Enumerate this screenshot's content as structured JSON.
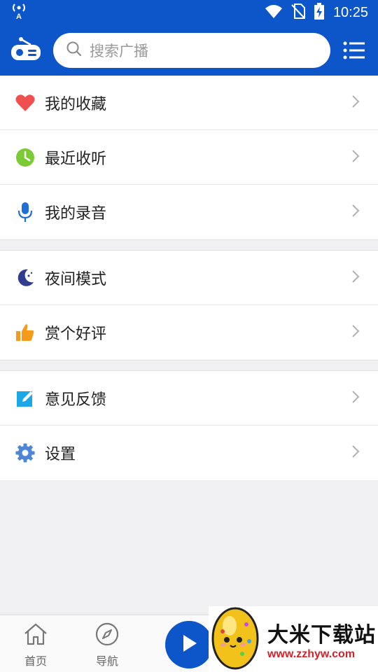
{
  "status_bar": {
    "time": "10:25"
  },
  "search": {
    "placeholder": "搜索广播"
  },
  "menu_groups": [
    [
      {
        "label": "我的收藏",
        "icon": "heart-icon",
        "color": "#ef4f4f"
      },
      {
        "label": "最近收听",
        "icon": "clock-icon",
        "color": "#7ccb34"
      },
      {
        "label": "我的录音",
        "icon": "microphone-icon",
        "color": "#1f6fd8"
      }
    ],
    [
      {
        "label": "夜间模式",
        "icon": "moon-icon",
        "color": "#2f3c8f"
      },
      {
        "label": "赏个好评",
        "icon": "thumbs-up-icon",
        "color": "#f59a1b"
      }
    ],
    [
      {
        "label": "意见反馈",
        "icon": "edit-icon",
        "color": "#1ea7e6"
      },
      {
        "label": "设置",
        "icon": "gear-icon",
        "color": "#4d86d6"
      }
    ]
  ],
  "bottom_nav": {
    "home": "首页",
    "nav": "导航"
  },
  "watermark": {
    "title": "大米下载站",
    "url": "www.zzhyw.com"
  },
  "colors": {
    "primary": "#0d56c9",
    "background": "#f0f0f2"
  }
}
